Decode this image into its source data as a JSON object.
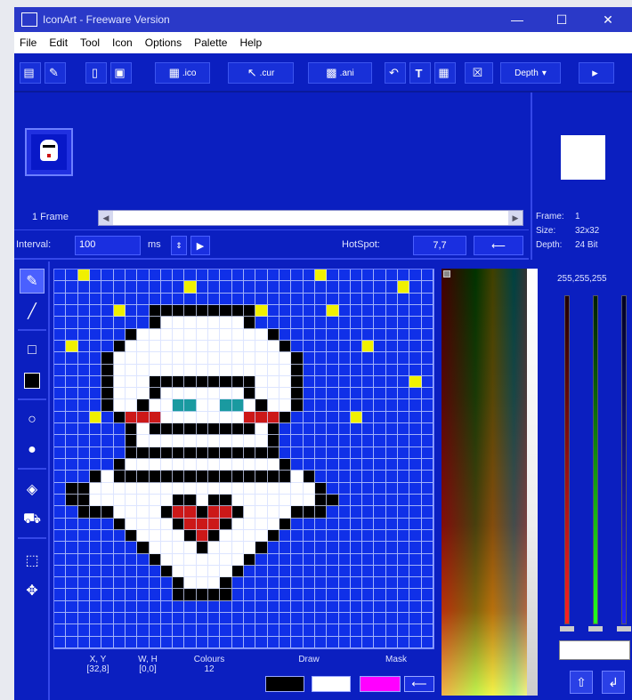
{
  "window": {
    "title": "IconArt - Freeware Version",
    "minimize": "—",
    "maximize": "☐",
    "close": "✕"
  },
  "menu": [
    "File",
    "Edit",
    "Tool",
    "Icon",
    "Options",
    "Palette",
    "Help"
  ],
  "toolbar": {
    "ico_label": ".ico",
    "cur_label": ".cur",
    "ani_label": ".ani",
    "depth_label": "Depth"
  },
  "frames": {
    "count_label": "1 Frame"
  },
  "interval": {
    "label": "Interval:",
    "value": "100",
    "unit": "ms",
    "hotspot_label": "HotSpot:",
    "hotspot_value": "7,7"
  },
  "info": {
    "frame_key": "Frame:",
    "frame_val": "1",
    "size_key": "Size:",
    "size_val": "32x32",
    "depth_key": "Depth:",
    "depth_val": "24 Bit"
  },
  "status": {
    "xy_label": "X, Y",
    "xy_val": "[32,8]",
    "wh_label": "W, H",
    "wh_val": "[0,0]",
    "colours_label": "Colours",
    "colours_val": "12",
    "draw_label": "Draw",
    "mask_label": "Mask"
  },
  "rgb": {
    "title": "255,255,255"
  },
  "colors": {
    "bg": "#1030e8",
    "white": "#ffffff",
    "black": "#000000",
    "yellow": "#f0f000",
    "teal": "#1a9aa0",
    "red": "#cc1818",
    "draw_color": "#000000",
    "draw_color2": "#ffffff",
    "mask_color": "#ff00ff"
  },
  "icons": {
    "tools": [
      "pencil-icon",
      "line-icon",
      "rect-outline-icon",
      "rect-fill-icon",
      "ellipse-outline-icon",
      "ellipse-fill-icon",
      "spray-icon",
      "fill-bucket-icon",
      "select-icon",
      "move-icon"
    ]
  }
}
